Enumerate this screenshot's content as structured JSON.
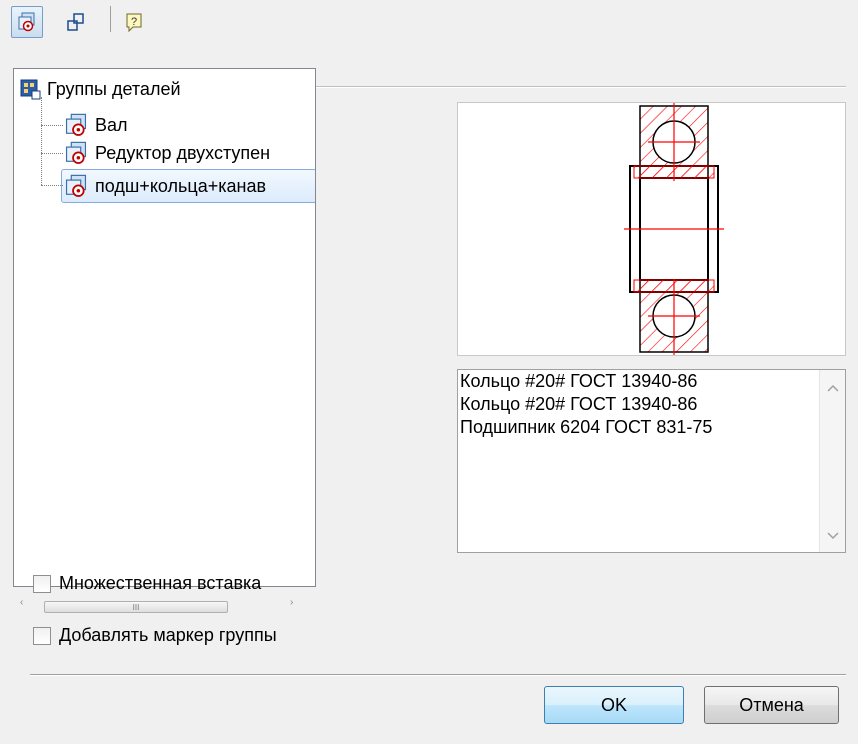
{
  "toolbar": {
    "buttons": [
      {
        "icon": "part-group-icon",
        "active": true
      },
      {
        "icon": "attach-icon",
        "active": false
      },
      {
        "icon": "help-icon",
        "active": false
      }
    ]
  },
  "tree": {
    "root": {
      "label": "Группы деталей",
      "icon": "part-groups-root-icon"
    },
    "items": [
      {
        "label": "Вал",
        "icon": "part-group-icon"
      },
      {
        "label": "Редуктор двухступен",
        "icon": "part-group-icon"
      },
      {
        "label": "подш+кольца+канав",
        "icon": "part-group-icon",
        "selected": true
      }
    ]
  },
  "hscroll": {
    "label": "III"
  },
  "details": {
    "lines": [
      "Кольцо #20# ГОСТ 13940-86",
      "Кольцо #20# ГОСТ 13940-86",
      "Подшипник 6204 ГОСТ 831-75"
    ]
  },
  "options": {
    "multi_insert": {
      "label": "Множественная вставка",
      "checked": false
    },
    "group_marker": {
      "label": "Добавлять маркер группы",
      "checked": false
    }
  },
  "buttons": {
    "ok": "OK",
    "cancel": "Отмена"
  },
  "colors": {
    "drawing_red": "#ff0000",
    "selection": "#84acdd",
    "default_button": "#3c7fb1"
  }
}
